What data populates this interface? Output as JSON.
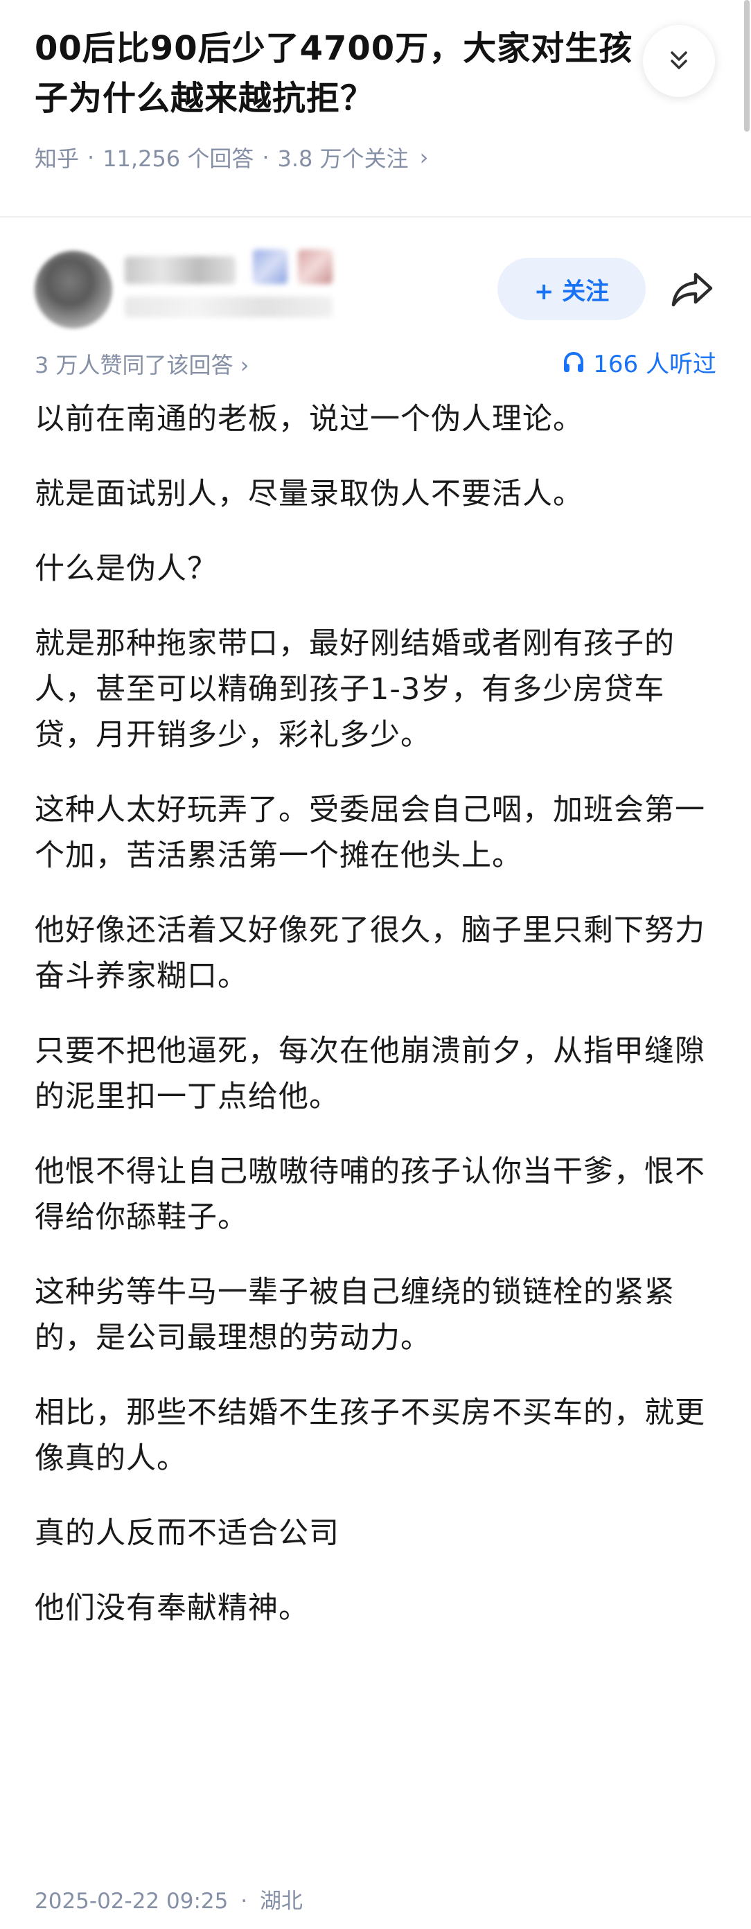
{
  "question": {
    "title_line1": "00后比90后少了4700万，大家对生孩",
    "title_line2": "子为什么越来越抗拒？",
    "meta_source": "知乎",
    "meta_answers": "11,256 个回答",
    "meta_followers": "3.8 万个关注",
    "meta_chevron": "›"
  },
  "author": {
    "follow_label": "+ 关注"
  },
  "stats": {
    "upvote_text": "3 万人赞同了该回答 ›",
    "listen_count": "166 人听过"
  },
  "paragraphs": [
    "以前在南通的老板，说过一个伪人理论。",
    "就是面试别人，尽量录取伪人不要活人。",
    "什么是伪人？",
    "就是那种拖家带口，最好刚结婚或者刚有孩子的人，甚至可以精确到孩子1-3岁，有多少房贷车贷，月开销多少，彩礼多少。",
    "这种人太好玩弄了。受委屈会自己咽，加班会第一个加，苦活累活第一个摊在他头上。",
    "他好像还活着又好像死了很久，脑子里只剩下努力奋斗养家糊口。",
    "只要不把他逼死，每次在他崩溃前夕，从指甲缝隙的泥里扣一丁点给他。",
    "他恨不得让自己嗷嗷待哺的孩子认你当干爹，恨不得给你舔鞋子。",
    "这种劣等牛马一辈子被自己缠绕的锁链栓的紧紧的，是公司最理想的劳动力。",
    "相比，那些不结婚不生孩子不买房不买车的，就更像真的人。",
    "真的人反而不适合公司",
    "他们没有奉献精神。"
  ],
  "footer": {
    "date": "2025-02-22 09:25",
    "location": "湖北"
  },
  "colors": {
    "accent": "#1772f6",
    "meta_gray": "#8590a6",
    "follow_bg": "#eaf1fc"
  }
}
